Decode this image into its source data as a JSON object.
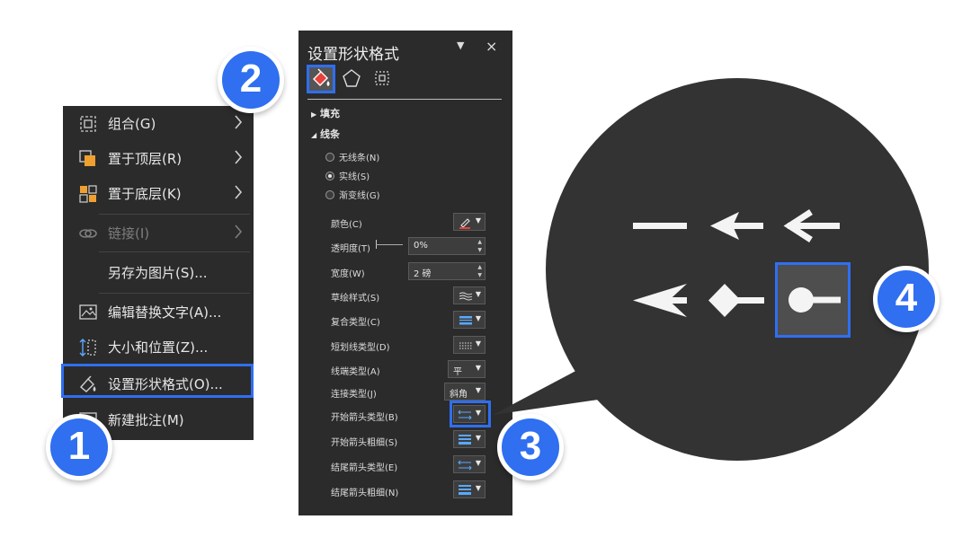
{
  "context_menu": {
    "items": [
      {
        "label": "组合(G)",
        "icon": "group-icon",
        "submenu": true,
        "disabled": false
      },
      {
        "label": "置于顶层(R)",
        "icon": "bring-to-front-icon",
        "submenu": true,
        "disabled": false
      },
      {
        "label": "置于底层(K)",
        "icon": "send-to-back-icon",
        "submenu": true,
        "disabled": false
      },
      {
        "label": "链接(I)",
        "icon": "link-icon",
        "submenu": true,
        "disabled": true
      },
      {
        "label": "另存为图片(S)...",
        "icon": "",
        "submenu": false,
        "disabled": false
      },
      {
        "label": "编辑替换文字(A)...",
        "icon": "alt-text-icon",
        "submenu": false,
        "disabled": false
      },
      {
        "label": "大小和位置(Z)...",
        "icon": "size-position-icon",
        "submenu": false,
        "disabled": false
      },
      {
        "label": "设置形状格式(O)...",
        "icon": "format-shape-icon",
        "submenu": false,
        "disabled": false,
        "highlighted": true
      },
      {
        "label": "新建批注(M)",
        "icon": "new-comment-icon",
        "submenu": false,
        "disabled": false
      }
    ]
  },
  "pane": {
    "title": "设置形状格式",
    "close": "×",
    "dropdown": "▼",
    "sections": {
      "fill": "填充",
      "line": "线条"
    },
    "line_options": [
      {
        "label": "无线条(N)",
        "selected": false
      },
      {
        "label": "实线(S)",
        "selected": true
      },
      {
        "label": "渐变线(G)",
        "selected": false
      }
    ],
    "props": {
      "color": "颜色(C)",
      "transparency": "透明度(T)",
      "transparency_value": "0%",
      "width": "宽度(W)",
      "width_value": "2 磅",
      "sketch": "草绘样式(S)",
      "compound": "复合类型(C)",
      "dash": "短划线类型(D)",
      "cap": "线端类型(A)",
      "cap_value": "平",
      "join": "连接类型(J)",
      "join_value": "斜角",
      "begin_type": "开始箭头类型(B)",
      "begin_size": "开始箭头粗细(S)",
      "end_type": "结尾箭头类型(E)",
      "end_size": "结尾箭头粗细(N)"
    }
  },
  "badges": [
    "1",
    "2",
    "3",
    "4"
  ],
  "colors": {
    "accent": "#2f6ff0",
    "panel": "#2b2b2b",
    "bubble": "#333333",
    "line_color_swatch": "#e8403a"
  }
}
